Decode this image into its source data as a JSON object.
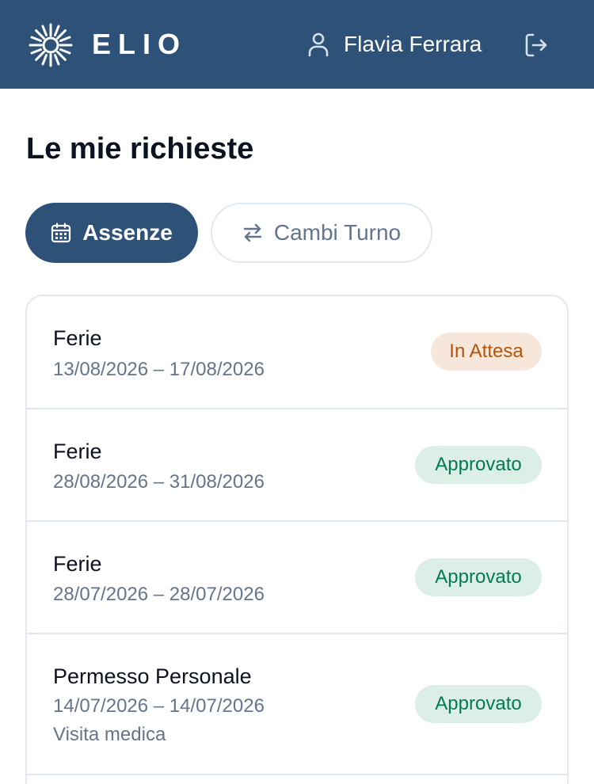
{
  "header": {
    "brand": "ELIO",
    "user_name": "Flavia Ferrara",
    "icons": {
      "logo": "sun-logo",
      "user": "user-icon",
      "logout": "logout-icon"
    }
  },
  "page": {
    "title": "Le mie richieste"
  },
  "tabs": [
    {
      "label": "Assenze",
      "icon": "calendar-icon",
      "active": true
    },
    {
      "label": "Cambi Turno",
      "icon": "swap-arrows-icon",
      "active": false
    }
  ],
  "requests": [
    {
      "type": "Ferie",
      "dates": "13/08/2026 – 17/08/2026",
      "status": "In Attesa",
      "note": ""
    },
    {
      "type": "Ferie",
      "dates": "28/08/2026 – 31/08/2026",
      "status": "Approvato",
      "note": ""
    },
    {
      "type": "Ferie",
      "dates": "28/07/2026 – 28/07/2026",
      "status": "Approvato",
      "note": ""
    },
    {
      "type": "Permesso Personale",
      "dates": "14/07/2026 – 14/07/2026",
      "status": "Approvato",
      "note": "Visita medica"
    }
  ],
  "colors": {
    "header_bg": "#2e5178",
    "pending_bg": "#f7e7da",
    "pending_text": "#b45309",
    "approved_bg": "#dcefe6",
    "approved_text": "#047857"
  }
}
